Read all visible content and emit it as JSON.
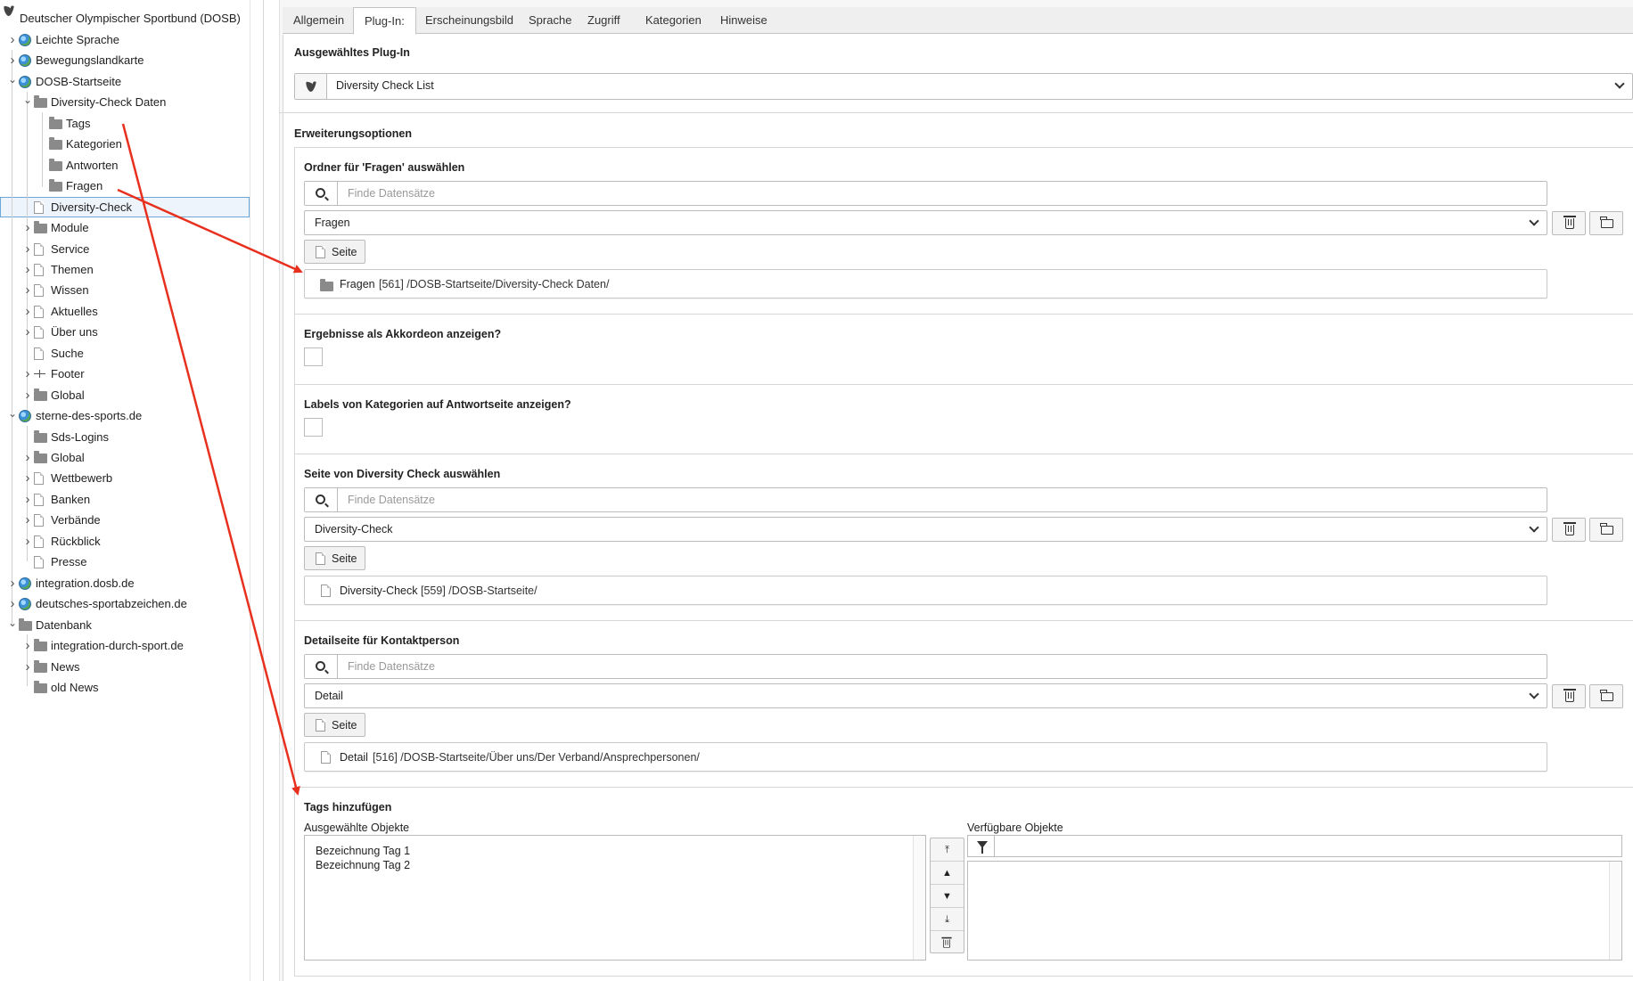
{
  "tree": {
    "root": "Deutscher Olympischer Sportbund (DOSB)",
    "items": [
      {
        "label": "Leichte Sprache",
        "icon": "globe-icon"
      },
      {
        "label": "Bewegungslandkarte",
        "icon": "globe-icon"
      },
      {
        "label": "DOSB-Startseite",
        "icon": "globe-icon"
      },
      {
        "label": "Diversity-Check Daten",
        "icon": "folder-icon"
      },
      {
        "label": "Tags",
        "icon": "folder-icon"
      },
      {
        "label": "Kategorien",
        "icon": "folder-icon"
      },
      {
        "label": "Antworten",
        "icon": "folder-icon"
      },
      {
        "label": "Fragen",
        "icon": "folder-icon"
      },
      {
        "label": "Diversity-Check",
        "icon": "page-icon"
      },
      {
        "label": "Module",
        "icon": "folder-icon"
      },
      {
        "label": "Service",
        "icon": "page-icon"
      },
      {
        "label": "Themen",
        "icon": "page-icon"
      },
      {
        "label": "Wissen",
        "icon": "page-icon"
      },
      {
        "label": "Aktuelles",
        "icon": "page-icon"
      },
      {
        "label": "Über uns",
        "icon": "page-icon"
      },
      {
        "label": "Suche",
        "icon": "page-icon"
      },
      {
        "label": "Footer",
        "icon": "separator-icon"
      },
      {
        "label": "Global",
        "icon": "folder-icon"
      },
      {
        "label": "sterne-des-sports.de",
        "icon": "globe-icon"
      },
      {
        "label": "Sds-Logins",
        "icon": "folder-icon"
      },
      {
        "label": "Global",
        "icon": "folder-icon"
      },
      {
        "label": "Wettbewerb",
        "icon": "page-icon"
      },
      {
        "label": "Banken",
        "icon": "page-icon"
      },
      {
        "label": "Verbände",
        "icon": "page-icon"
      },
      {
        "label": "Rückblick",
        "icon": "page-icon"
      },
      {
        "label": "Presse",
        "icon": "page-icon"
      },
      {
        "label": "integration.dosb.de",
        "icon": "globe-icon"
      },
      {
        "label": "deutsches-sportabzeichen.de",
        "icon": "globe-icon"
      },
      {
        "label": "Datenbank",
        "icon": "folder-icon"
      },
      {
        "label": "integration-durch-sport.de",
        "icon": "folder-icon"
      },
      {
        "label": "News",
        "icon": "folder-icon"
      },
      {
        "label": "old News",
        "icon": "folder-icon"
      }
    ]
  },
  "tabs": [
    "Allgemein",
    "Plug-In:",
    "Erscheinungsbild",
    "Sprache",
    "Zugriff",
    "Kategorien",
    "Hinweise"
  ],
  "plugin": {
    "heading": "Ausgewähltes Plug-In",
    "selected": "Diversity Check List"
  },
  "options_heading": "Erweiterungsoptionen",
  "fragen": {
    "heading": "Ordner für 'Fragen' auswählen",
    "search_placeholder": "Finde Datensätze",
    "selected": "Fragen",
    "button": "Seite",
    "record_name": "Fragen",
    "record_path": "[561] /DOSB-Startseite/Diversity-Check Daten/"
  },
  "akkordeon": {
    "heading": "Ergebnisse als Akkordeon anzeigen?"
  },
  "labels": {
    "heading": "Labels von Kategorien auf Antwortseite anzeigen?"
  },
  "seite": {
    "heading": "Seite von Diversity Check auswählen",
    "search_placeholder": "Finde Datensätze",
    "selected": "Diversity-Check",
    "button": "Seite",
    "record_name": "Diversity-Check",
    "record_path": "[559] /DOSB-Startseite/"
  },
  "detail": {
    "heading": "Detailseite für Kontaktperson",
    "search_placeholder": "Finde Datensätze",
    "selected": "Detail",
    "button": "Seite",
    "record_name": "Detail",
    "record_path": "[516] /DOSB-Startseite/Über uns/Der Verband/Ansprechpersonen/"
  },
  "tags": {
    "heading": "Tags hinzufügen",
    "selected_label": "Ausgewählte Objekte",
    "available_label": "Verfügbare Objekte",
    "selected_items": [
      "Bezeichnung Tag 1",
      "Bezeichnung Tag 2"
    ]
  },
  "colors": {
    "annotation_arrow": "#e8301f",
    "selected_border": "#6fa6d8"
  }
}
